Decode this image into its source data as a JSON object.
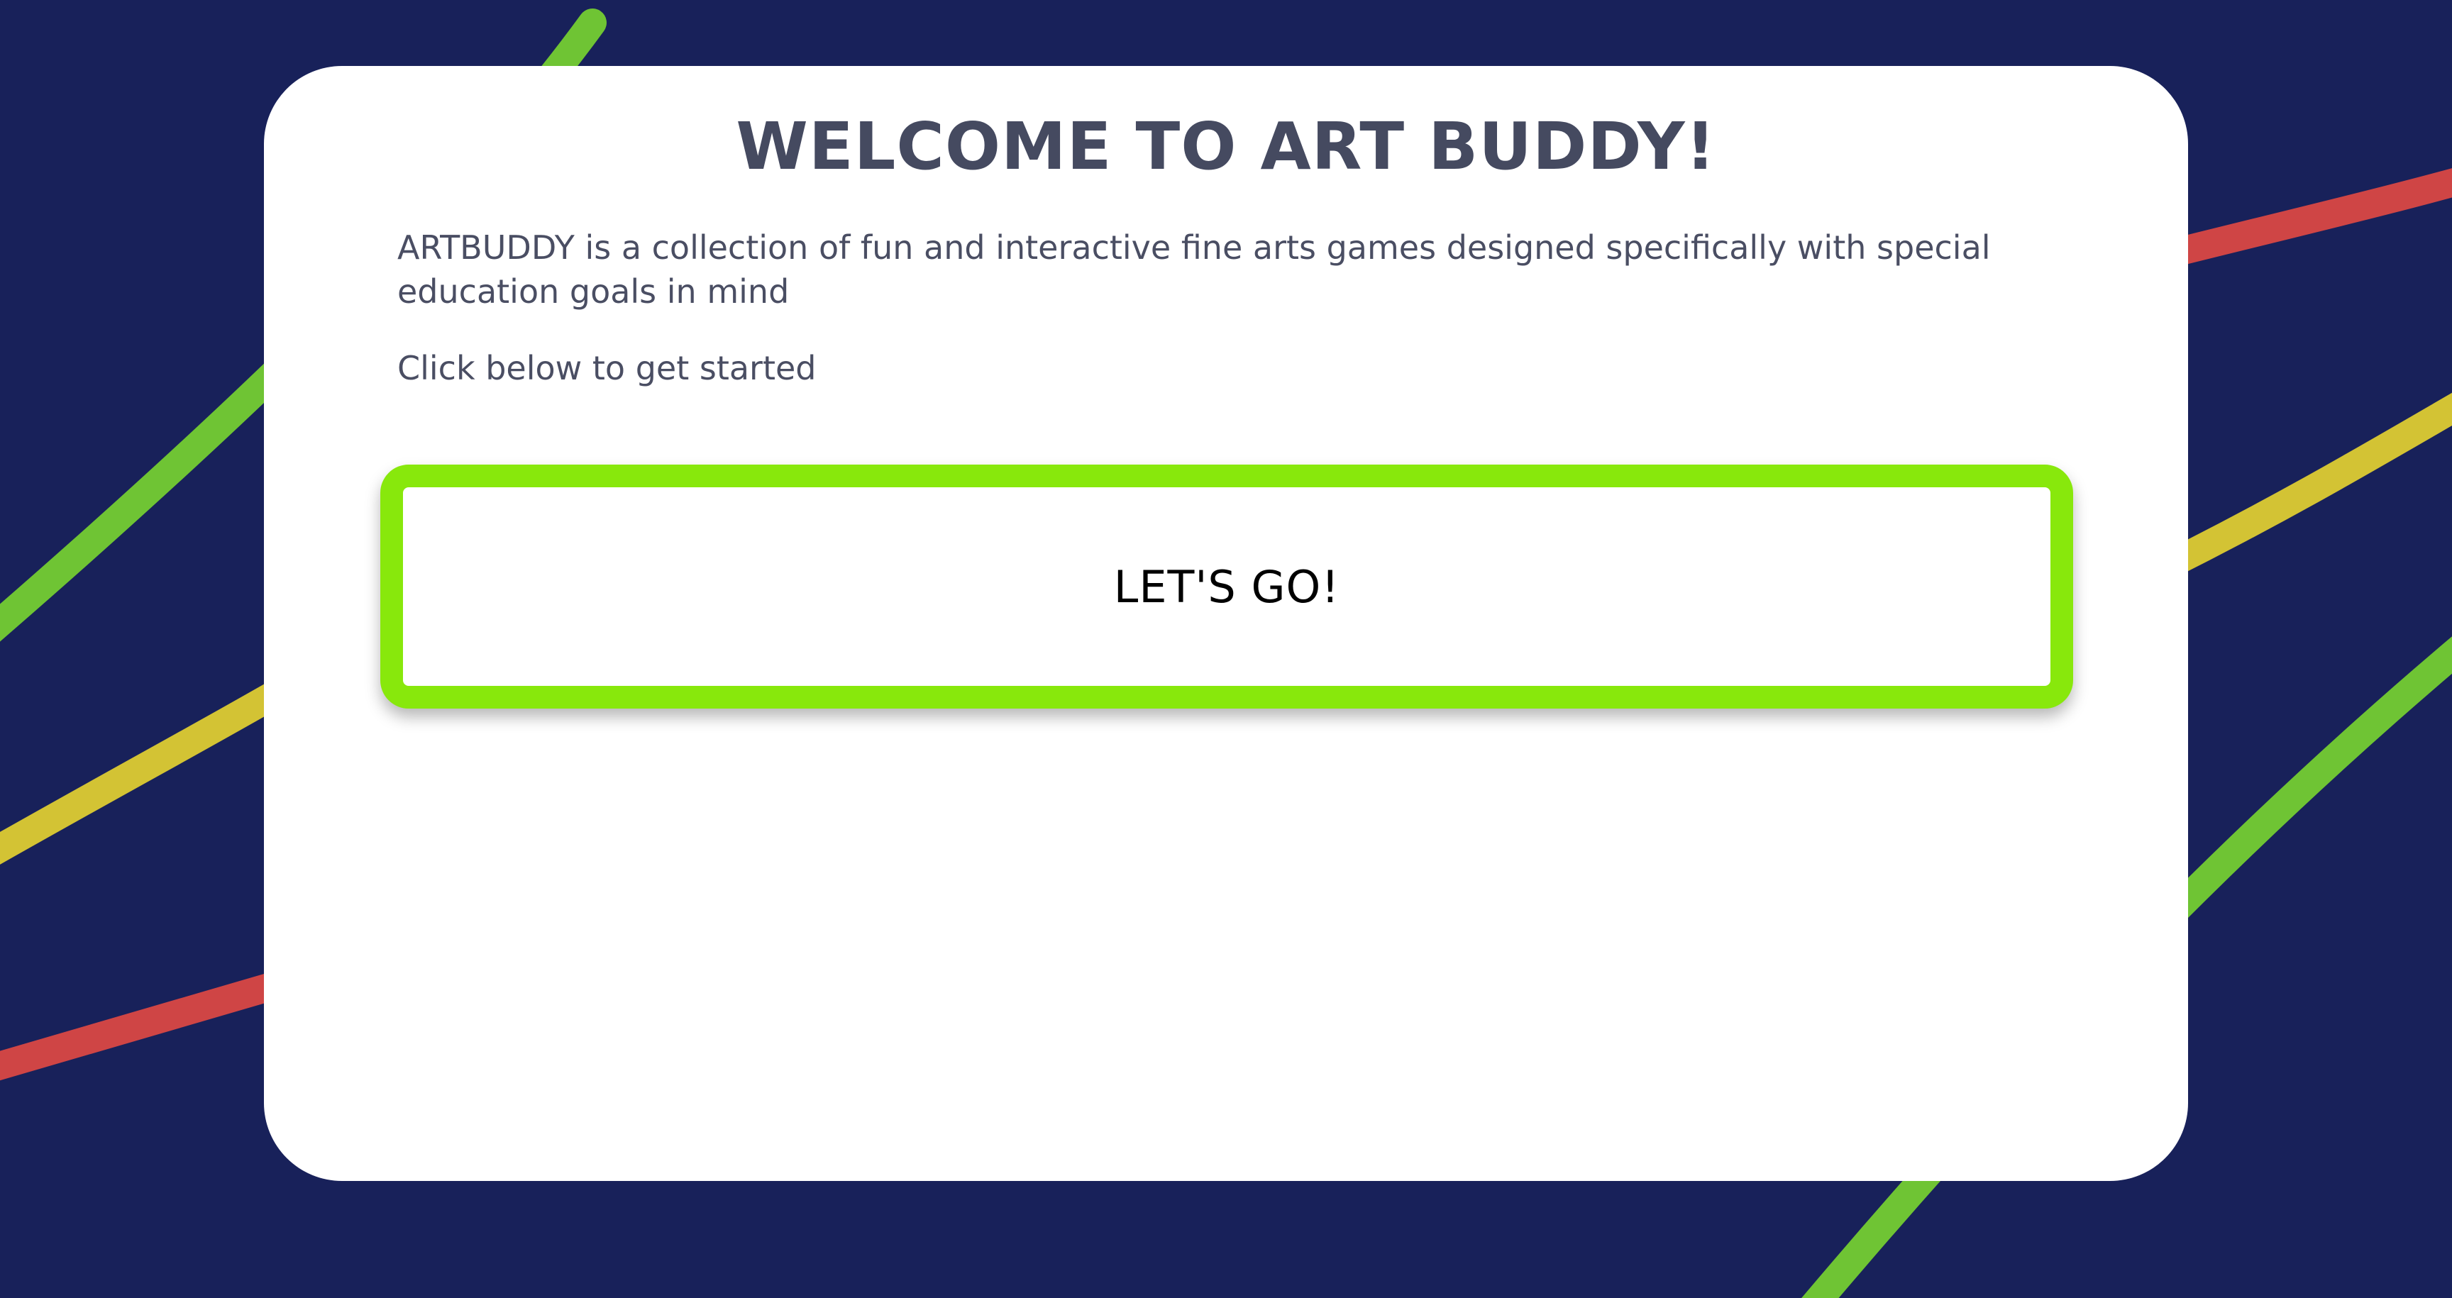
{
  "colors": {
    "background": "#18215a",
    "card": "#ffffff",
    "text": "#4a4e63",
    "button_border": "#88e80c",
    "stripe_green": "#6fc434",
    "stripe_yellow": "#d3c334",
    "stripe_red": "#cf4545"
  },
  "welcome": {
    "title": "WELCOME TO ART BUDDY!",
    "intro": "ARTBUDDY is a collection of fun and interactive fine arts games designed specifically with special education goals in mind",
    "cta_text": "Click below to get started"
  },
  "button": {
    "label": "LET'S GO!"
  }
}
